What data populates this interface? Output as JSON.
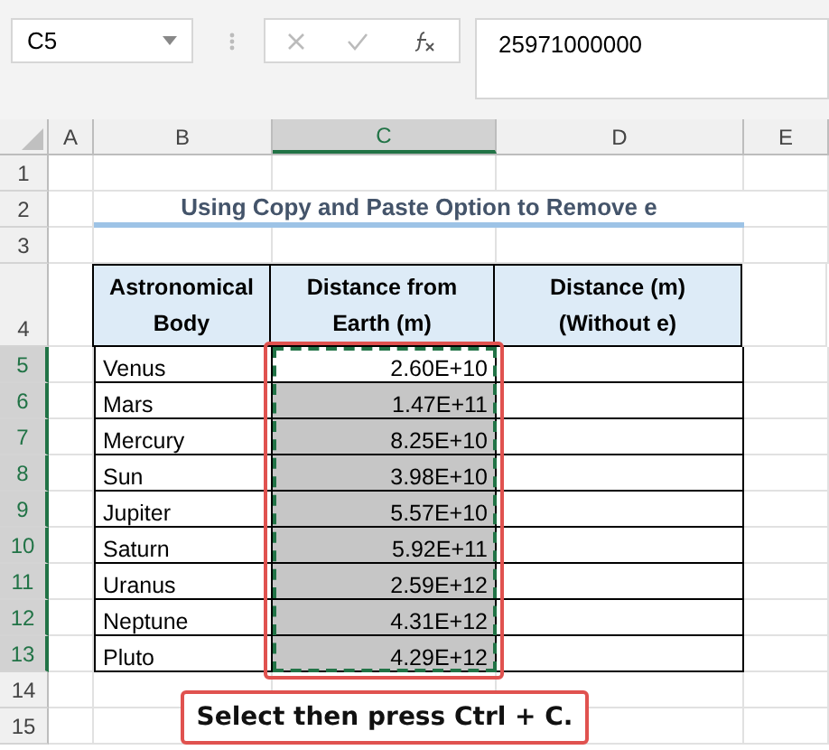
{
  "name_box": {
    "value": "C5"
  },
  "formula_bar": {
    "value": "25971000000"
  },
  "columns": [
    {
      "label": "A",
      "selected": false
    },
    {
      "label": "B",
      "selected": false
    },
    {
      "label": "C",
      "selected": true
    },
    {
      "label": "D",
      "selected": false
    },
    {
      "label": "E",
      "selected": false
    }
  ],
  "title": "Using Copy and Paste Option to Remove e",
  "table": {
    "columns": [
      "Astronomical Body",
      "Distance from Earth (m)",
      "Distance (m) (Without e)"
    ],
    "rows": [
      {
        "body": "Venus",
        "distance": "2.60E+10",
        "active": true
      },
      {
        "body": "Mars",
        "distance": "1.47E+11",
        "active": false
      },
      {
        "body": "Mercury",
        "distance": "8.25E+10",
        "active": false
      },
      {
        "body": "Sun",
        "distance": "3.98E+10",
        "active": false
      },
      {
        "body": "Jupiter",
        "distance": "5.57E+10",
        "active": false
      },
      {
        "body": "Saturn",
        "distance": "5.92E+11",
        "active": false
      },
      {
        "body": "Uranus",
        "distance": "2.59E+12",
        "active": false
      },
      {
        "body": "Neptune",
        "distance": "4.31E+12",
        "active": false
      },
      {
        "body": "Pluto",
        "distance": "4.29E+12",
        "active": false
      }
    ]
  },
  "row_numbers": [
    {
      "label": "1",
      "selected": false
    },
    {
      "label": "2",
      "selected": false
    },
    {
      "label": "3",
      "selected": false
    },
    {
      "label": "4",
      "selected": false
    },
    {
      "label": "5",
      "selected": true
    },
    {
      "label": "6",
      "selected": true
    },
    {
      "label": "7",
      "selected": true
    },
    {
      "label": "8",
      "selected": true
    },
    {
      "label": "9",
      "selected": true
    },
    {
      "label": "10",
      "selected": true
    },
    {
      "label": "11",
      "selected": true
    },
    {
      "label": "12",
      "selected": true
    },
    {
      "label": "13",
      "selected": true
    },
    {
      "label": "14",
      "selected": false
    },
    {
      "label": "15",
      "selected": false
    }
  ],
  "callout": "Select then press Ctrl + C."
}
